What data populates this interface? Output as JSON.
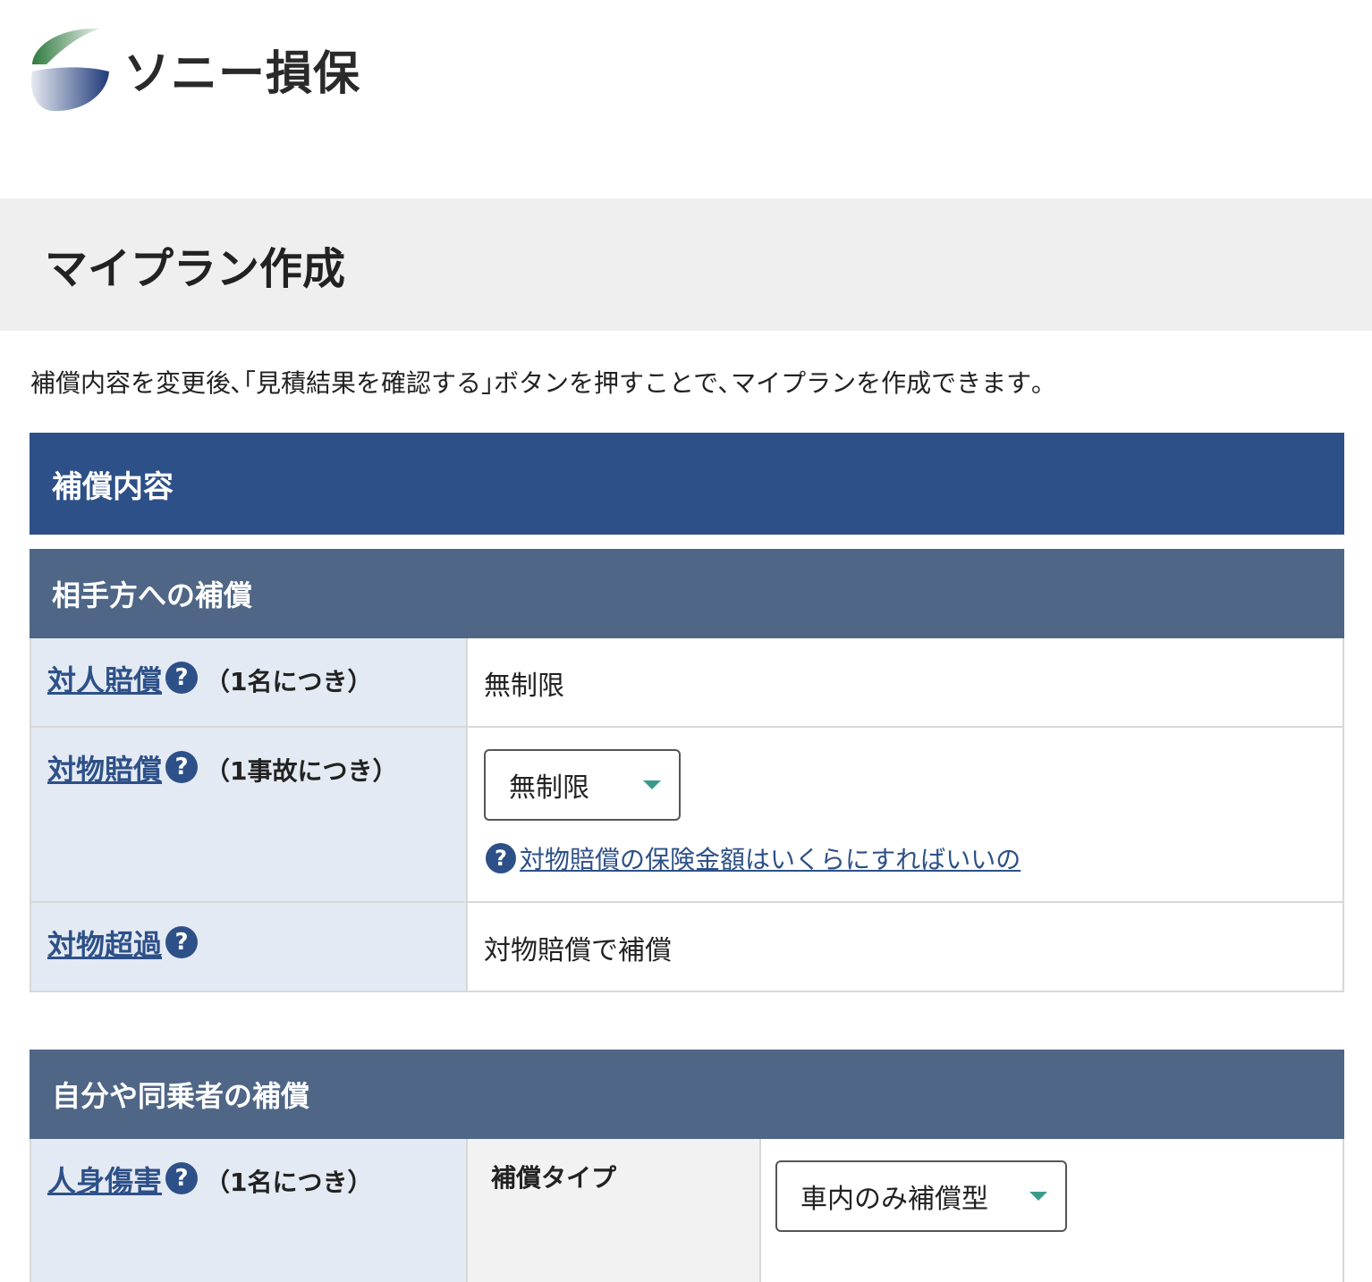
{
  "brand": {
    "name": "ソニー損保"
  },
  "page": {
    "title": "マイプラン作成",
    "intro": "補償内容を変更後､｢見積結果を確認する｣ボタンを押すことで､マイプランを作成できます｡"
  },
  "coverage": {
    "heading": "補償内容",
    "sections": [
      {
        "heading": "相手方への補償",
        "rows": [
          {
            "term": "対人賠償",
            "note": "（1名につき）",
            "value": "無制限"
          },
          {
            "term": "対物賠償",
            "note": "（1事故につき）",
            "select_value": "無制限",
            "help_link": "対物賠償の保険金額はいくらにすればいいの"
          },
          {
            "term": "対物超過",
            "value": "対物賠償で補償"
          }
        ]
      },
      {
        "heading": "自分や同乗者の補償",
        "rows": [
          {
            "term": "人身傷害",
            "note": "（1名につき）",
            "sub_label": "補償タイプ",
            "select_value": "車内のみ補償型"
          }
        ]
      }
    ]
  },
  "icons": {
    "help": "?"
  },
  "colors": {
    "primary": "#2d5088",
    "secondary": "#4f6686",
    "label_bg": "#e4eaf3",
    "caret": "#3a9a8a"
  }
}
